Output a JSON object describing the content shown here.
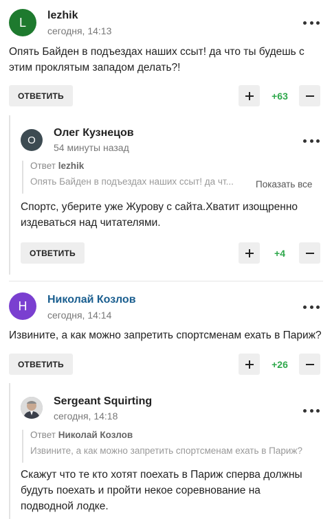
{
  "actions": {
    "reply": "ОТВЕТИТЬ",
    "show_all": "Показать все",
    "answer_prefix": "Ответ"
  },
  "comments": [
    {
      "avatar_letter": "L",
      "avatar_color": "#1e7a2e",
      "author": "lezhik",
      "time": "сегодня, 14:13",
      "text": "Опять Байден в подъездах наших ссыт! да что ты будешь с этим проклятым западом делать?!",
      "score": "+63"
    },
    {
      "avatar_letter": "О",
      "avatar_color": "#3d4b52",
      "author": "Олег Кузнецов",
      "time": "54 минуты назад",
      "quote_author": "lezhik",
      "quote_text": "Опять Байден в подъездах наших ссыт! да чт...",
      "text": "Спортс, уберите уже Журову с сайта.Хватит изощренно издеваться над читателями.",
      "score": "+4"
    },
    {
      "avatar_letter": "Н",
      "avatar_color": "#7a3fd0",
      "author": "Николай Козлов",
      "time": "сегодня, 14:14",
      "text": "Извините, а как можно запретить спортсменам ехать в Париж?",
      "score": "+26"
    },
    {
      "avatar_color": "#9aa0a6",
      "author": "Sergeant Squirting",
      "time": "сегодня, 14:18",
      "quote_author": "Николай Козлов",
      "quote_text": "Извините, а как можно запретить спортсменам ехать в Париж?",
      "text": "Скажут что те кто хотят поехать в Париж сперва должны будуть поехать и пройти некое соревнование на подводной лодке."
    }
  ],
  "icons": {
    "more": "more-dots-icon",
    "plus": "plus-icon",
    "minus": "minus-icon"
  }
}
